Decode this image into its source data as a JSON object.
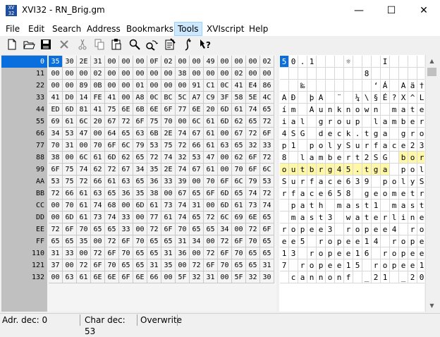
{
  "window": {
    "title": "XVI32 - RN_Brig.gm",
    "icon_text": "XVI32",
    "minimize": "—",
    "maximize": "☐",
    "close": "✕"
  },
  "menu": [
    {
      "label": "File"
    },
    {
      "label": "Edit"
    },
    {
      "label": "Search"
    },
    {
      "label": "Address"
    },
    {
      "label": "Bookmarks"
    },
    {
      "label": "Tools"
    },
    {
      "label": "XVIscript"
    },
    {
      "label": "Help"
    }
  ],
  "toolbar": [
    "new-file-icon",
    "open-folder-icon",
    "save-icon",
    "close-x-icon",
    "cut-icon",
    "copy-icon",
    "paste-icon",
    "find-icon",
    "replace-icon",
    "properties-icon",
    "script-icon",
    "help-icon"
  ],
  "rows": [
    {
      "addr": "0",
      "hex": [
        "35",
        "30",
        "2E",
        "31",
        "00",
        "00",
        "00",
        "0F",
        "02",
        "00",
        "00",
        "49",
        "00",
        "00",
        "00",
        "02"
      ],
      "chars": [
        "5",
        "0",
        ".",
        "1",
        "",
        "",
        "",
        "☼",
        "",
        "",
        "",
        "I",
        "",
        "",
        "",
        ""
      ]
    },
    {
      "addr": "11",
      "hex": [
        "00",
        "00",
        "00",
        "02",
        "00",
        "00",
        "00",
        "00",
        "00",
        "38",
        "00",
        "00",
        "00",
        "02",
        "00",
        "00"
      ],
      "chars": [
        "",
        "",
        "",
        "",
        "",
        "",
        "",
        "",
        "",
        "8",
        "",
        "",
        "",
        "",
        "",
        ""
      ]
    },
    {
      "addr": "22",
      "hex": [
        "00",
        "00",
        "89",
        "0B",
        "00",
        "00",
        "01",
        "00",
        "00",
        "00",
        "91",
        "C1",
        "0C",
        "41",
        "E4",
        "86"
      ],
      "chars": [
        "",
        "",
        "‰",
        "",
        "",
        "",
        "",
        "",
        "",
        "",
        "‘",
        "Á",
        "",
        "A",
        "ä",
        "†"
      ]
    },
    {
      "addr": "33",
      "hex": [
        "41",
        "D0",
        "14",
        "FE",
        "41",
        "00",
        "A8",
        "0C",
        "BC",
        "5C",
        "A7",
        "C9",
        "3F",
        "58",
        "5E",
        "4C"
      ],
      "chars": [
        "A",
        "Ð",
        "",
        "þ",
        "A",
        "",
        "¨",
        "",
        "¼",
        "\\",
        "§",
        "É",
        "?",
        "X",
        "^",
        "L"
      ]
    },
    {
      "addr": "44",
      "hex": [
        "ED",
        "6D",
        "81",
        "41",
        "75",
        "6E",
        "6B",
        "6E",
        "6F",
        "77",
        "6E",
        "20",
        "6D",
        "61",
        "74",
        "65"
      ],
      "chars": [
        "í",
        "m",
        "",
        "A",
        "u",
        "n",
        "k",
        "n",
        "o",
        "w",
        "n",
        "",
        "m",
        "a",
        "t",
        "e"
      ]
    },
    {
      "addr": "55",
      "hex": [
        "69",
        "61",
        "6C",
        "20",
        "67",
        "72",
        "6F",
        "75",
        "70",
        "00",
        "6C",
        "61",
        "6D",
        "62",
        "65",
        "72"
      ],
      "chars": [
        "i",
        "a",
        "l",
        "",
        "g",
        "r",
        "o",
        "u",
        "p",
        "",
        "l",
        "a",
        "m",
        "b",
        "e",
        "r"
      ]
    },
    {
      "addr": "66",
      "hex": [
        "34",
        "53",
        "47",
        "00",
        "64",
        "65",
        "63",
        "6B",
        "2E",
        "74",
        "67",
        "61",
        "00",
        "67",
        "72",
        "6F"
      ],
      "chars": [
        "4",
        "S",
        "G",
        "",
        "d",
        "e",
        "c",
        "k",
        ".",
        "t",
        "g",
        "a",
        "",
        "g",
        "r",
        "o"
      ]
    },
    {
      "addr": "77",
      "hex": [
        "70",
        "31",
        "00",
        "70",
        "6F",
        "6C",
        "79",
        "53",
        "75",
        "72",
        "66",
        "61",
        "63",
        "65",
        "32",
        "33"
      ],
      "chars": [
        "p",
        "1",
        "",
        "p",
        "o",
        "l",
        "y",
        "S",
        "u",
        "r",
        "f",
        "a",
        "c",
        "e",
        "2",
        "3"
      ]
    },
    {
      "addr": "88",
      "hex": [
        "38",
        "00",
        "6C",
        "61",
        "6D",
        "62",
        "65",
        "72",
        "74",
        "32",
        "53",
        "47",
        "00",
        "62",
        "6F",
        "72"
      ],
      "chars": [
        "8",
        "",
        "l",
        "a",
        "m",
        "b",
        "e",
        "r",
        "t",
        "2",
        "S",
        "G",
        "",
        "b",
        "o",
        "r"
      ]
    },
    {
      "addr": "99",
      "hex": [
        "6F",
        "75",
        "74",
        "62",
        "72",
        "67",
        "34",
        "35",
        "2E",
        "74",
        "67",
        "61",
        "00",
        "70",
        "6F",
        "6C"
      ],
      "chars": [
        "o",
        "u",
        "t",
        "b",
        "r",
        "g",
        "4",
        "5",
        ".",
        "t",
        "g",
        "a",
        "",
        "p",
        "o",
        "l"
      ]
    },
    {
      "addr": "AA",
      "hex": [
        "53",
        "75",
        "72",
        "66",
        "61",
        "63",
        "65",
        "36",
        "33",
        "39",
        "00",
        "70",
        "6F",
        "6C",
        "79",
        "53"
      ],
      "chars": [
        "S",
        "u",
        "r",
        "f",
        "a",
        "c",
        "e",
        "6",
        "3",
        "9",
        "",
        "p",
        "o",
        "l",
        "y",
        "S"
      ]
    },
    {
      "addr": "BB",
      "hex": [
        "72",
        "66",
        "61",
        "63",
        "65",
        "36",
        "35",
        "38",
        "00",
        "67",
        "65",
        "6F",
        "6D",
        "65",
        "74",
        "72"
      ],
      "chars": [
        "r",
        "f",
        "a",
        "c",
        "e",
        "6",
        "5",
        "8",
        "",
        "g",
        "e",
        "o",
        "m",
        "e",
        "t",
        "r"
      ]
    },
    {
      "addr": "CC",
      "hex": [
        "00",
        "70",
        "61",
        "74",
        "68",
        "00",
        "6D",
        "61",
        "73",
        "74",
        "31",
        "00",
        "6D",
        "61",
        "73",
        "74"
      ],
      "chars": [
        "",
        "p",
        "a",
        "t",
        "h",
        "",
        "m",
        "a",
        "s",
        "t",
        "1",
        "",
        "m",
        "a",
        "s",
        "t"
      ]
    },
    {
      "addr": "DD",
      "hex": [
        "00",
        "6D",
        "61",
        "73",
        "74",
        "33",
        "00",
        "77",
        "61",
        "74",
        "65",
        "72",
        "6C",
        "69",
        "6E",
        "65"
      ],
      "chars": [
        "",
        "m",
        "a",
        "s",
        "t",
        "3",
        "",
        "w",
        "a",
        "t",
        "e",
        "r",
        "l",
        "i",
        "n",
        "e"
      ]
    },
    {
      "addr": "EE",
      "hex": [
        "72",
        "6F",
        "70",
        "65",
        "65",
        "33",
        "00",
        "72",
        "6F",
        "70",
        "65",
        "65",
        "34",
        "00",
        "72",
        "6F"
      ],
      "chars": [
        "r",
        "o",
        "p",
        "e",
        "e",
        "3",
        "",
        "r",
        "o",
        "p",
        "e",
        "e",
        "4",
        "",
        "r",
        "o"
      ]
    },
    {
      "addr": "FF",
      "hex": [
        "65",
        "65",
        "35",
        "00",
        "72",
        "6F",
        "70",
        "65",
        "65",
        "31",
        "34",
        "00",
        "72",
        "6F",
        "70",
        "65"
      ],
      "chars": [
        "e",
        "e",
        "5",
        "",
        "r",
        "o",
        "p",
        "e",
        "e",
        "1",
        "4",
        "",
        "r",
        "o",
        "p",
        "e"
      ]
    },
    {
      "addr": "110",
      "hex": [
        "31",
        "33",
        "00",
        "72",
        "6F",
        "70",
        "65",
        "65",
        "31",
        "36",
        "00",
        "72",
        "6F",
        "70",
        "65",
        "65"
      ],
      "chars": [
        "1",
        "3",
        "",
        "r",
        "o",
        "p",
        "e",
        "e",
        "1",
        "6",
        "",
        "r",
        "o",
        "p",
        "e",
        "e"
      ]
    },
    {
      "addr": "121",
      "hex": [
        "37",
        "00",
        "72",
        "6F",
        "70",
        "65",
        "65",
        "31",
        "35",
        "00",
        "72",
        "6F",
        "70",
        "65",
        "65",
        "31"
      ],
      "chars": [
        "7",
        "",
        "r",
        "o",
        "p",
        "e",
        "e",
        "1",
        "5",
        "",
        "r",
        "o",
        "p",
        "e",
        "e",
        "1"
      ]
    },
    {
      "addr": "132",
      "hex": [
        "00",
        "63",
        "61",
        "6E",
        "6E",
        "6F",
        "6E",
        "66",
        "00",
        "5F",
        "32",
        "31",
        "00",
        "5F",
        "32",
        "30"
      ],
      "chars": [
        "",
        "c",
        "a",
        "n",
        "n",
        "o",
        "n",
        "f",
        "",
        "_",
        "2",
        "1",
        "",
        "_",
        "2",
        "0"
      ]
    }
  ],
  "highlight": [
    {
      "row": 8,
      "from": 13,
      "to": 15
    },
    {
      "row": 9,
      "from": 0,
      "to": 11
    }
  ],
  "status": {
    "address": "Adr. dec: 0",
    "char": "Char dec: 53",
    "mode": "Overwrite"
  },
  "colors": {
    "selection": "#0a6fde",
    "highlight": "#fff7a8",
    "address_bg": "#c0c0c0"
  }
}
